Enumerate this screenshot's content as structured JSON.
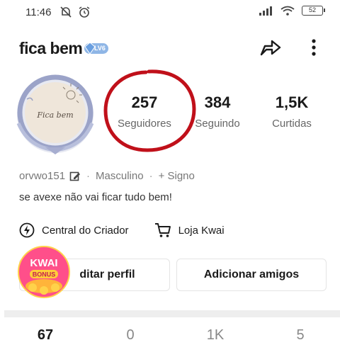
{
  "status_bar": {
    "time": "11:46",
    "left_icons": [
      "mute-icon",
      "alarm-icon"
    ],
    "right_icons": [
      "signal-icon",
      "wifi-icon",
      "battery-icon"
    ],
    "battery": "52"
  },
  "profile": {
    "username": "fica bem",
    "level": "LV6",
    "avatar_text": "Fica bem"
  },
  "stats": {
    "followers": {
      "value": "257",
      "label": "Seguidores"
    },
    "following": {
      "value": "384",
      "label": "Seguindo"
    },
    "likes": {
      "value": "1,5K",
      "label": "Curtidas"
    }
  },
  "meta": {
    "user_id": "orvwo151",
    "gender": "Masculino",
    "sign": "+ Signo"
  },
  "bio": "se avexe não vai ficar tudo bem!",
  "creator": {
    "center": "Central do Criador",
    "store": "Loja Kwai"
  },
  "buttons": {
    "edit_profile": "ditar perfil",
    "add_friends": "Adicionar amigos"
  },
  "kwai_bonus": {
    "line1": "KWAI",
    "line2": "BONUS"
  },
  "tab_counts": [
    "67",
    "0",
    "1K",
    "5"
  ],
  "colors": {
    "highlight_circle": "#c0101a",
    "badge": "#8fb6e6",
    "bonus": "#ff4f8a"
  }
}
